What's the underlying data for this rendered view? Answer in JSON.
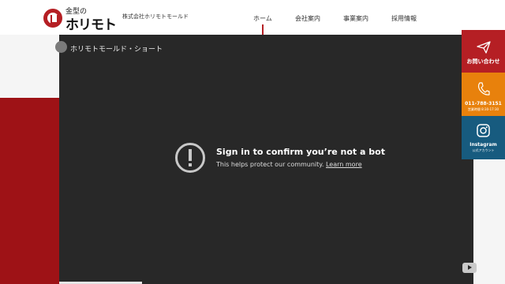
{
  "header": {
    "logo_small": "金型の",
    "logo_big": "ホリモト",
    "corp_name": "株式会社ホリモトモールド",
    "nav": [
      {
        "label": "ホーム"
      },
      {
        "label": "会社案内"
      },
      {
        "label": "事業案内"
      },
      {
        "label": "採用情報"
      }
    ]
  },
  "video": {
    "channel_title": "ホリモトモールド・ショート",
    "error_title": "Sign in to confirm you’re not a bot",
    "error_sub": "This helps protect our community.",
    "learn_more": "Learn more"
  },
  "side_panel": {
    "contact_label": "お問い合わせ",
    "phone_number": "011-788-3151",
    "phone_hours": "営業時間 8:30-17:30",
    "instagram_label": "Instagram",
    "instagram_sub": "公式アカウント"
  },
  "colors": {
    "brand_red": "#b51f24",
    "orange": "#e8810c",
    "navy": "#175b7f",
    "video_bg": "#282828"
  }
}
